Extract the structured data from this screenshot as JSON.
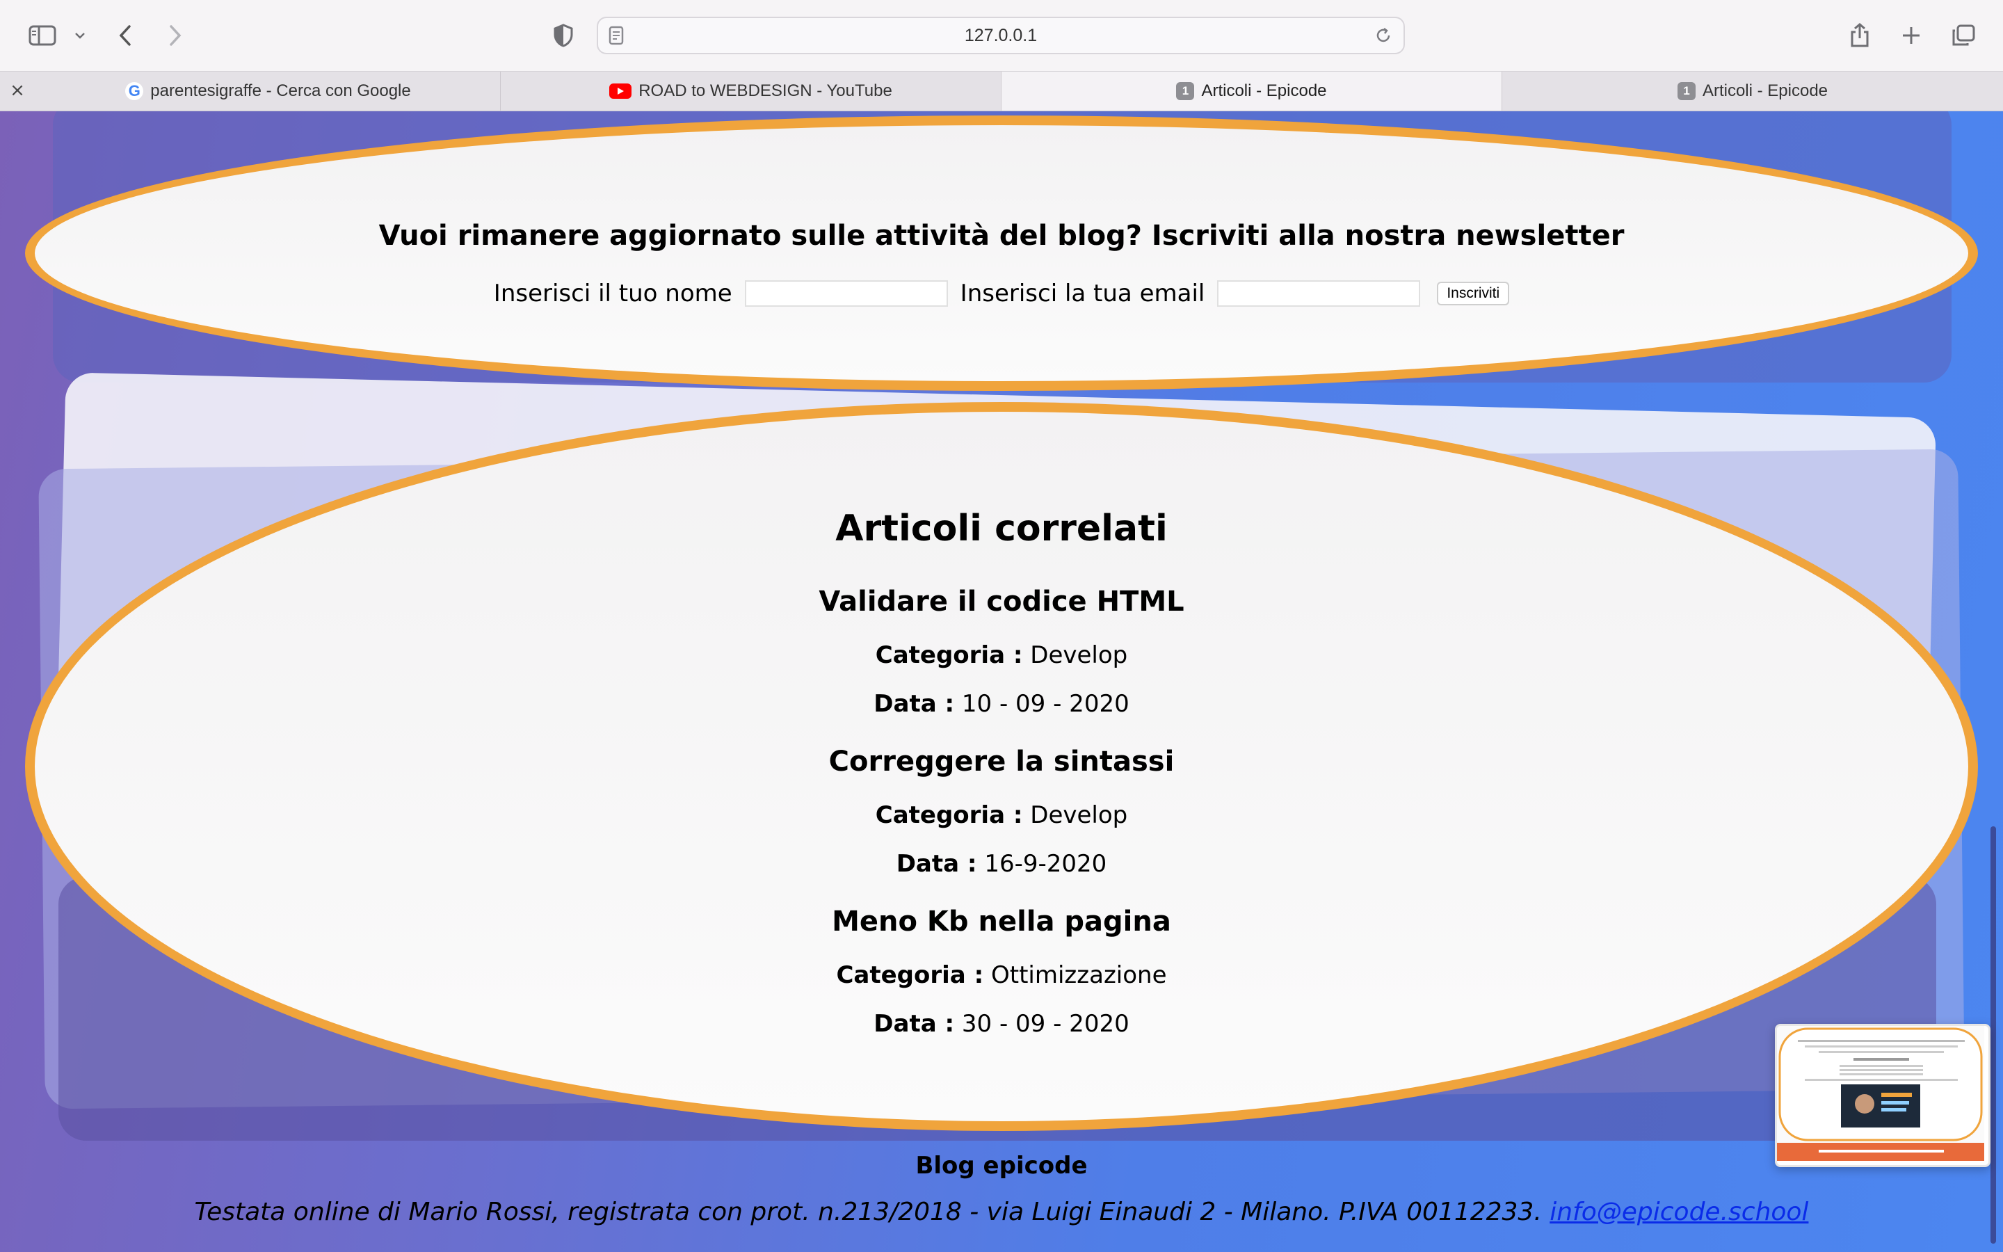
{
  "browser": {
    "url": "127.0.0.1",
    "tabs": [
      {
        "label": "parentesigraffe - Cerca con Google",
        "favicon": "google-icon",
        "active": false
      },
      {
        "label": "ROAD to WEBDESIGN - YouTube",
        "favicon": "youtube-icon",
        "active": false
      },
      {
        "label": "Articoli - Epicode",
        "favicon": "1",
        "active": true
      },
      {
        "label": "Articoli - Epicode",
        "favicon": "1",
        "active": false
      }
    ],
    "close_glyph": "×"
  },
  "newsletter": {
    "title": "Vuoi rimanere aggiornato sulle attività del blog? Iscriviti alla nostra newsletter",
    "name_label": "Inserisci il tuo nome",
    "name_value": "",
    "email_label": "Inserisci la tua email",
    "email_value": "",
    "submit_label": "Inscriviti"
  },
  "related": {
    "title": "Articoli correlati",
    "category_label": "Categoria :",
    "date_label": "Data :",
    "articles": [
      {
        "title": "Validare il codice HTML",
        "category": "Develop",
        "date": "10 - 09 - 2020"
      },
      {
        "title": "Correggere la sintassi",
        "category": "Develop",
        "date": "16-9-2020"
      },
      {
        "title": "Meno Kb nella pagina",
        "category": "Ottimizzazione",
        "date": "30 - 09 - 2020"
      }
    ]
  },
  "footer": {
    "title": "Blog epicode",
    "text": "Testata online di Mario Rossi, registrata con prot. n.213/2018 - via Luigi Einaudi 2 - Milano. P.IVA 00112233.",
    "email": "info@epicode.school"
  },
  "colors": {
    "panel_border": "#f0a43c",
    "gradient_start": "#7b61b8",
    "gradient_end": "#4c86f0",
    "link": "#0a2be8"
  }
}
